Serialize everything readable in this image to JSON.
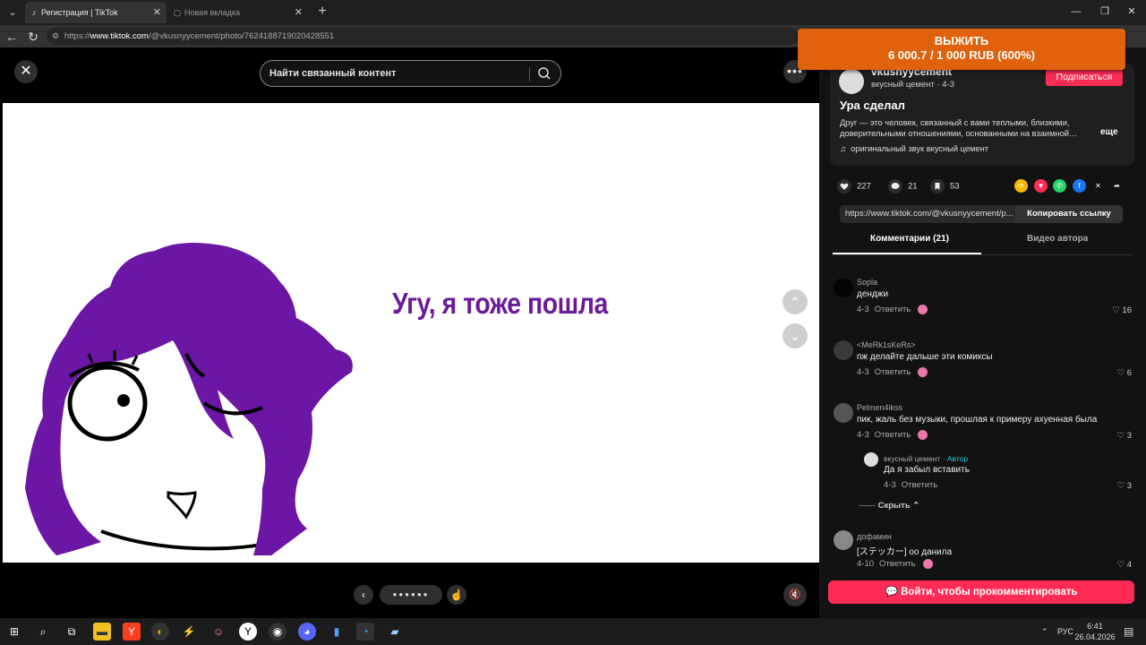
{
  "browser": {
    "tabs": [
      {
        "title": "Регистрация | TikTok",
        "active": true,
        "icon": "tiktok-icon"
      },
      {
        "title": "Новая вкладка",
        "active": false,
        "icon": "newtab-icon"
      }
    ],
    "url_prefix": "https://",
    "url_host": "www.tiktok.com",
    "url_path": "/@vkusnyycement/photo/7624188719020428551"
  },
  "overlay": {
    "line1": "ВЫЖИТЬ",
    "line2": "6 000.7 / 1 000 RUB (600%)",
    "color": "#e0620c"
  },
  "viewer": {
    "search_placeholder": "Найти связанный контент",
    "caption": "Угу, я тоже пошла",
    "caption_color": "#6a1b9a"
  },
  "author": {
    "name": "vkusnyycement",
    "subtitle": "вкусный цемент · 4-3",
    "follow_label": "Подписаться",
    "title": "Ура сделал",
    "description": "Друг — это человек, связанный с вами теплыми, близкими, доверительными отношениями, основанными на взаимной…",
    "more_label": "еще",
    "sound": "оригинальный звук вкусный цемент"
  },
  "stats": {
    "likes": "227",
    "comments": "21",
    "saves": "53"
  },
  "share": {
    "link_text": "https://www.tiktok.com/@vkusnyycement/p...",
    "copy_label": "Копировать ссылку"
  },
  "panel_tabs": {
    "comments": "Комментарии (21)",
    "author_videos": "Видео автора"
  },
  "comments": [
    {
      "user": "Sopla",
      "text": "денджи",
      "date": "4-3",
      "reply": "Ответить",
      "likes": "16"
    },
    {
      "user": "<MeRk1sKeRs>",
      "text": "пж делайте дальше эти комиксы",
      "date": "4-3",
      "reply": "Ответить",
      "likes": "6"
    },
    {
      "user": "Pelmen4ikss",
      "text": "пик, жаль без музыки, прошлая к примеру ахуенная была",
      "date": "4-3",
      "reply": "Ответить",
      "likes": "3"
    },
    {
      "user": "вкусный цемент",
      "author_tag": "· Автор",
      "text": "Да я забыл вставить",
      "date": "4-3",
      "reply": "Ответить",
      "likes": "3"
    },
    {
      "user": "дофамин",
      "text": "[ステッカー] оо данила",
      "date": "4-10",
      "reply": "Ответить",
      "likes": "4"
    }
  ],
  "hide_label": "Скрыть",
  "login_button": "Войти, чтобы прокомментировать",
  "taskbar": {
    "lang": "РУС",
    "time": "6:41",
    "date": "26.04.2026"
  }
}
